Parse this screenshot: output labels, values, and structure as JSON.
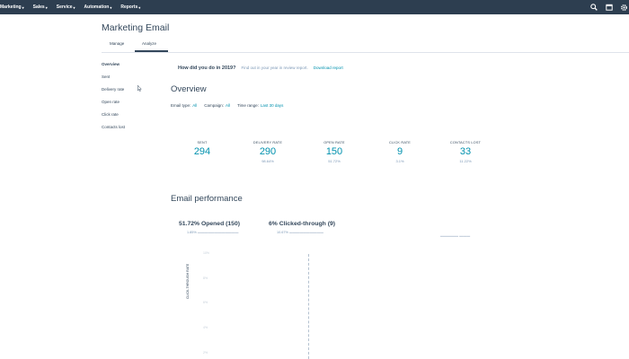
{
  "nav": {
    "items": [
      "Marketing",
      "Sales",
      "Service",
      "Automation",
      "Reports"
    ],
    "icons": [
      "search-icon",
      "marketplace-icon",
      "settings-icon"
    ]
  },
  "page": {
    "title": "Marketing Email",
    "tabs": [
      "Manage",
      "Analyze"
    ],
    "active_tab": "Analyze"
  },
  "sidebar": {
    "items": [
      "Overview",
      "Sent",
      "Delivery rate",
      "Open rate",
      "Click rate",
      "Contacts lost"
    ],
    "active": "Overview"
  },
  "promo": {
    "title": "How did you do in 2019?",
    "text": "Find out in your year in review report.",
    "link": "Download report"
  },
  "overview": {
    "title": "Overview",
    "filters": [
      {
        "label": "Email type:",
        "value": "All"
      },
      {
        "label": "Campaign:",
        "value": "All"
      },
      {
        "label": "Time range:",
        "value": "Last 30 days"
      }
    ],
    "stats": [
      {
        "label": "SENT",
        "value": "294",
        "sub": ""
      },
      {
        "label": "DELIVERY RATE",
        "value": "290",
        "sub": "98.64%"
      },
      {
        "label": "OPEN RATE",
        "value": "150",
        "sub": "51.72%"
      },
      {
        "label": "CLICK RATE",
        "value": "9",
        "sub": "3.1%"
      },
      {
        "label": "CONTACTS LOST",
        "value": "33",
        "sub": "11.22%"
      }
    ]
  },
  "performance": {
    "title": "Email performance",
    "metrics": [
      {
        "label": "51.72% Opened (150)",
        "sub_value": "1.85%"
      },
      {
        "label": "6% Clicked-through (9)",
        "sub_value": "10.67%"
      }
    ],
    "y_axis_title": "CLICK-THROUGH RATE",
    "y_ticks": [
      "10%",
      "8%",
      "6%",
      "4%",
      "2%"
    ]
  },
  "colors": {
    "nav_bg": "#2d3e50",
    "text": "#33475b",
    "link": "#0091ae",
    "muted": "#7c98b6"
  }
}
